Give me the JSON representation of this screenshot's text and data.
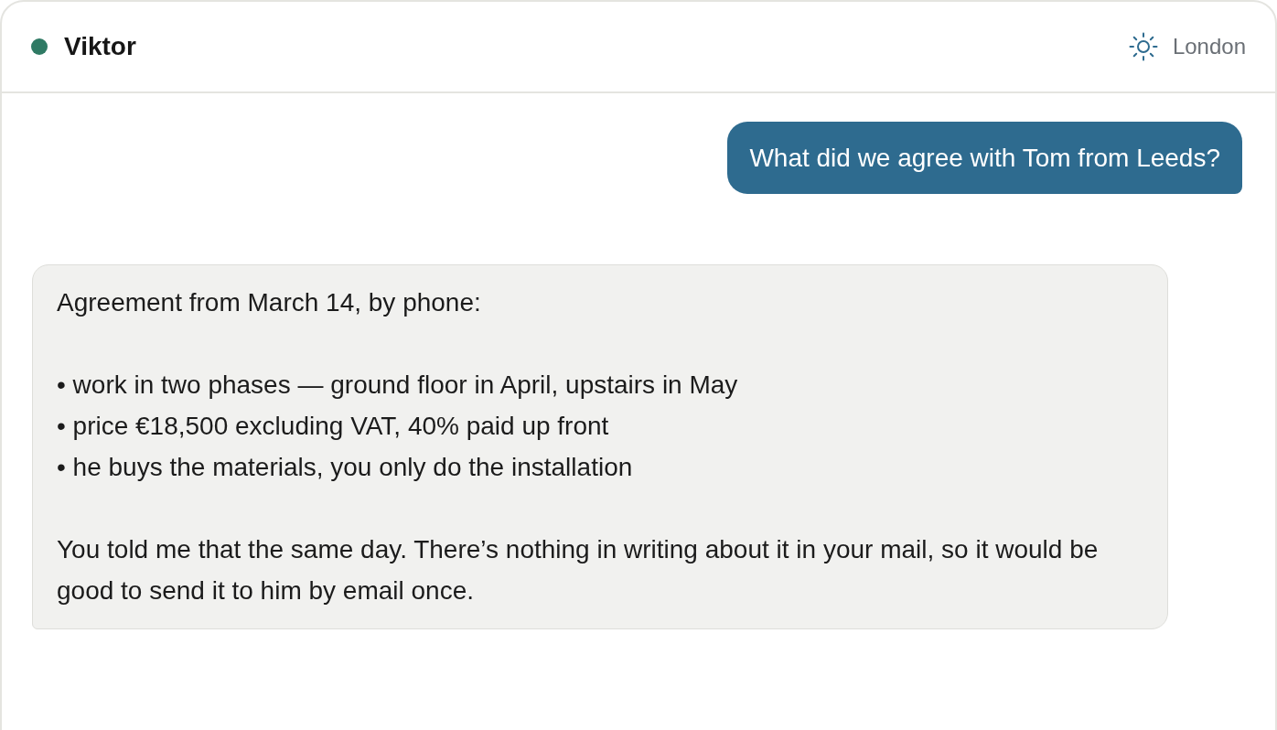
{
  "header": {
    "contact": {
      "name": "Viktor",
      "online": true
    },
    "location": {
      "city": "London"
    }
  },
  "messages": [
    {
      "kind": "user",
      "text": "What did we agree with Tom from Leeds?"
    },
    {
      "kind": "assistant",
      "blocks": [
        {
          "kind": "paragraph",
          "text": "Agreement from March 14, by phone:"
        },
        {
          "kind": "bullets",
          "items": [
            "• work in two phases — ground floor in April, upstairs in May",
            "• price €18,500 excluding VAT, 40% paid up front",
            "• he buys the materials, you only do the installation"
          ]
        },
        {
          "kind": "paragraph",
          "text": "You told me that the same day. There’s nothing in writing about it in your mail, so it would be good to send it to him by email once."
        }
      ]
    }
  ]
}
